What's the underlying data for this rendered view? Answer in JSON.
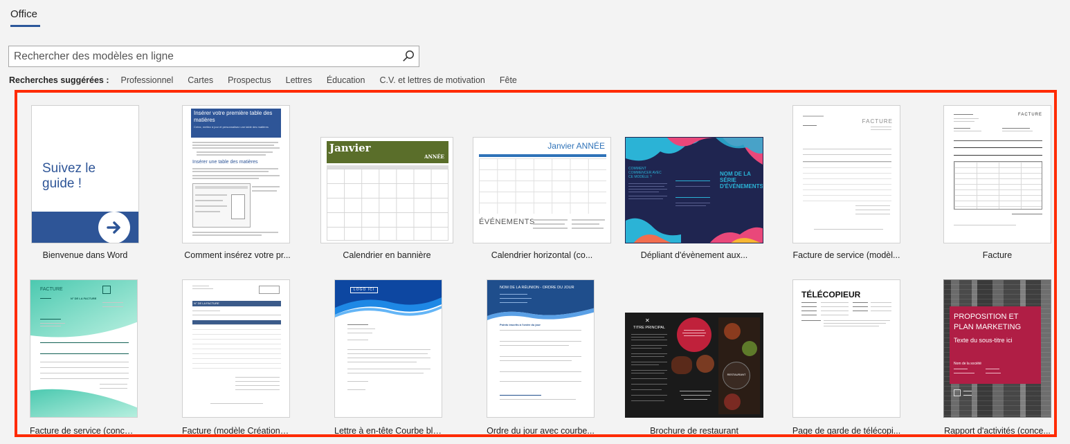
{
  "header": {
    "tab_label": "Office"
  },
  "search": {
    "placeholder": "Rechercher des modèles en ligne",
    "value": ""
  },
  "suggested": {
    "label": "Recherches suggérées :",
    "items": [
      "Professionnel",
      "Cartes",
      "Prospectus",
      "Lettres",
      "Éducation",
      "C.V. et lettres de motivation",
      "Fête"
    ]
  },
  "templates_row1": [
    {
      "name": "Bienvenue dans Word",
      "thumb_text": "Suivez le guide !",
      "accent": "#2e5597"
    },
    {
      "name": "Comment insérez votre pr...",
      "thumb_title": "Insérer votre première table des matières",
      "thumb_subtitle": "Créez, mettez à jour et personnalisez une table des matières",
      "thumb_heading": "Insérer une table des matières",
      "accent": "#2e5597"
    },
    {
      "name": "Calendrier en bannière",
      "thumb_title": "Janvier",
      "thumb_year": "ANNÉE",
      "accent": "#5a6e2a"
    },
    {
      "name": "Calendrier horizontal (co...",
      "thumb_title": "Janvier",
      "thumb_year": "ANNÉE",
      "thumb_events": "ÉVÉNEMENTS",
      "accent": "#2e72b8"
    },
    {
      "name": "Dépliant d'évènement aux...",
      "thumb_title": "NOM DE LA SÉRIE D'ÉVÉNEMENTS",
      "thumb_question": "COMMENT COMMENCER AVEC CE MODÈLE ?",
      "accent": "#1f2550"
    },
    {
      "name": "Facture de service (modèl...",
      "thumb_title": "FACTURE"
    },
    {
      "name": "Facture",
      "thumb_title": "FACTURE"
    }
  ],
  "templates_row2": [
    {
      "name": "Facture de service (concep...",
      "thumb_title": "FACTURE",
      "thumb_invoice_no": "N° DE LA FACTURE",
      "accent": "#3fbfa8"
    },
    {
      "name": "Facture (modèle Création i...",
      "thumb_title": "N° DE LA FACTURE",
      "accent": "#3b5b8a"
    },
    {
      "name": "Lettre à en-tête Courbe ble...",
      "thumb_logo": "LOGO ICI",
      "accent": "#1565c0"
    },
    {
      "name": "Ordre du jour avec courbe...",
      "thumb_title": "NOM DE LA RÉUNION - ORDRE DU JOUR",
      "thumb_heading": "Points inscrits à l'ordre du jour",
      "accent": "#1f4e8c"
    },
    {
      "name": "Brochure de restaurant",
      "thumb_title": "TITRE PRINCIPAL",
      "thumb_badge": "RESTAURANT",
      "accent": "#c0213b"
    },
    {
      "name": "Page de garde de télécopi...",
      "thumb_title": "TÉLÉCOPIEUR"
    },
    {
      "name": "Rapport d'activités (conce...",
      "thumb_title": "PROPOSITION ET PLAN MARKETING",
      "thumb_subtitle": "Texte du sous-titre ici",
      "thumb_company": "Nom de la société",
      "accent": "#b01e45"
    }
  ]
}
